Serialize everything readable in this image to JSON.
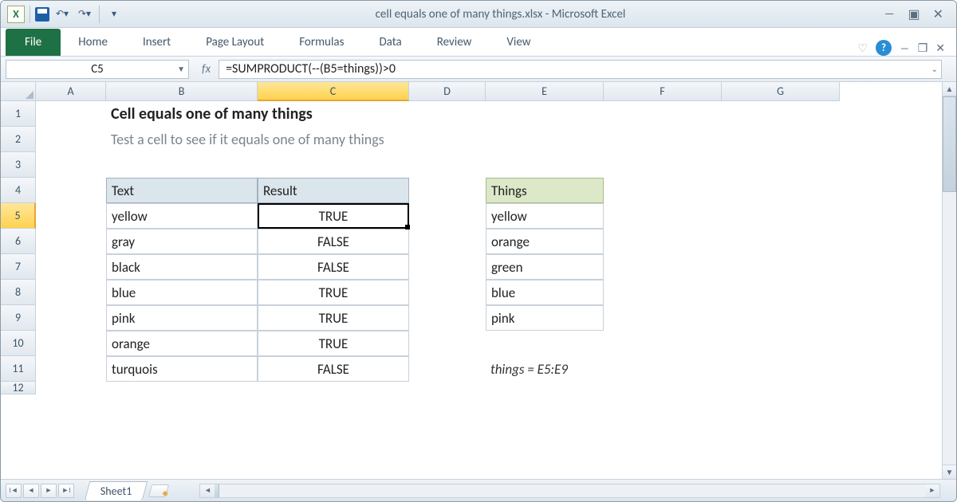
{
  "title": "cell equals one of many things.xlsx  -  Microsoft Excel",
  "ribbon": {
    "file": "File",
    "tabs": [
      "Home",
      "Insert",
      "Page Layout",
      "Formulas",
      "Data",
      "Review",
      "View"
    ]
  },
  "namebox": "C5",
  "formula": "=SUMPRODUCT(--(B5=things))>0",
  "cols": [
    "A",
    "B",
    "C",
    "D",
    "E",
    "F",
    "G"
  ],
  "rows": [
    "1",
    "2",
    "3",
    "4",
    "5",
    "6",
    "7",
    "8",
    "9",
    "10",
    "11",
    "12"
  ],
  "content": {
    "heading": "Cell equals one of many things",
    "sub": "Test a cell to see if it equals one of many things",
    "thText": "Text",
    "thResult": "Result",
    "thThings": "Things",
    "text": [
      "yellow",
      "gray",
      "black",
      "blue",
      "pink",
      "orange",
      "turquois"
    ],
    "result": [
      "TRUE",
      "FALSE",
      "FALSE",
      "TRUE",
      "TRUE",
      "TRUE",
      "FALSE"
    ],
    "things": [
      "yellow",
      "orange",
      "green",
      "blue",
      "pink"
    ],
    "note": "things = E5:E9"
  },
  "sheet": "Sheet1"
}
